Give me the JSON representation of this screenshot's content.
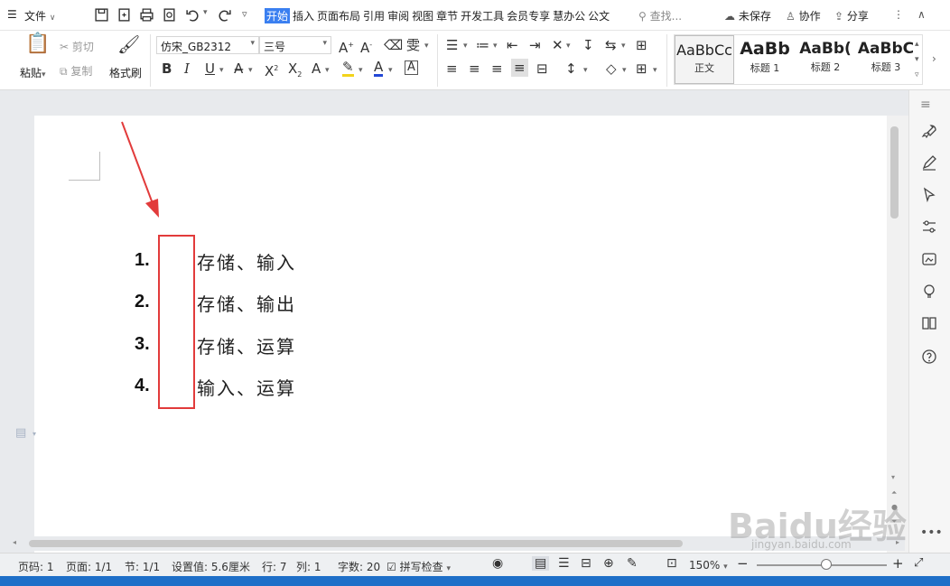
{
  "menubar": {
    "file_label": "文件",
    "tabs": [
      {
        "label": "开始",
        "active": true
      },
      {
        "label": "插入",
        "active": false
      },
      {
        "label": "页面布局",
        "active": false
      },
      {
        "label": "引用",
        "active": false
      },
      {
        "label": "审阅",
        "active": false
      },
      {
        "label": "视图",
        "active": false
      },
      {
        "label": "章节",
        "active": false
      },
      {
        "label": "开发工具",
        "active": false
      },
      {
        "label": "会员专享",
        "active": false
      },
      {
        "label": "慧办公",
        "active": false
      },
      {
        "label": "公文",
        "active": false
      }
    ],
    "search_placeholder": "查找...",
    "unsaved_label": "未保存",
    "collab_label": "协作",
    "share_label": "分享"
  },
  "ribbon": {
    "paste_label": "粘贴",
    "cut_label": "剪切",
    "copy_label": "复制",
    "format_painter_label": "格式刷",
    "font_name": "仿宋_GB2312",
    "font_size": "三号",
    "styles": [
      {
        "preview": "AaBbCc",
        "name": "正文"
      },
      {
        "preview": "AaBb",
        "name": "标题 1"
      },
      {
        "preview": "AaBb(",
        "name": "标题 2"
      },
      {
        "preview": "AaBbC",
        "name": "标题 3"
      }
    ]
  },
  "document": {
    "list_items": [
      {
        "number": "1.",
        "text": "存储、输入"
      },
      {
        "number": "2.",
        "text": "存储、输出"
      },
      {
        "number": "3.",
        "text": "存储、运算"
      },
      {
        "number": "4.",
        "text": "输入、运算"
      }
    ]
  },
  "statusbar": {
    "page_code": "页码: 1",
    "page": "页面: 1/1",
    "section": "节: 1/1",
    "setting": "设置值: 5.6厘米",
    "line": "行: 7",
    "column": "列: 1",
    "word_count": "字数: 20",
    "spell_check": "拼写检查",
    "zoom": "150%"
  },
  "watermark": {
    "main": "Baidu经验",
    "sub": "jingyan.baidu.com"
  },
  "colors": {
    "accent": "#3a7ff0",
    "annotation": "#e23b3b",
    "taskbar": "#1e6fc8"
  }
}
